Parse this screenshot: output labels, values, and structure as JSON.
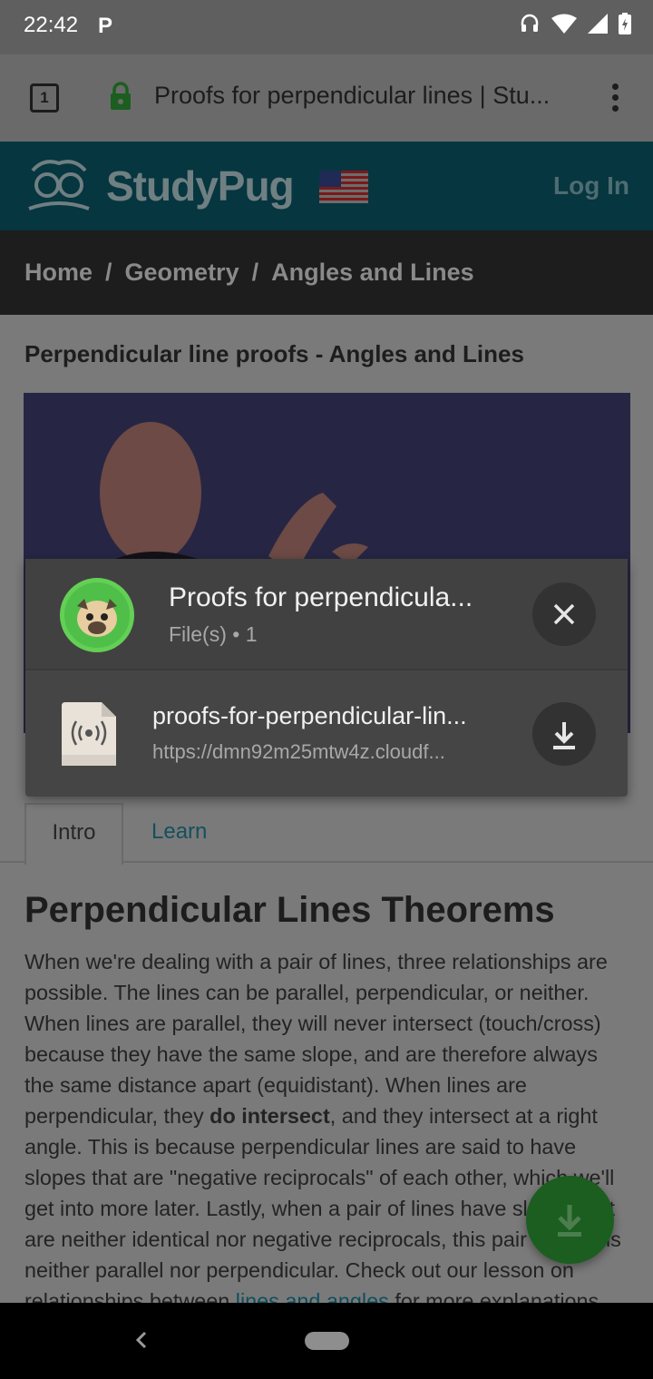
{
  "status_bar": {
    "time": "22:42",
    "notification_letter": "P"
  },
  "toolbar": {
    "tab_count": "1",
    "url": "Proofs for perpendicular lines | Stu..."
  },
  "site_header": {
    "logo_text": "StudyPug",
    "login_label": "Log In"
  },
  "breadcrumb": {
    "items": [
      "Home",
      "Geometry",
      "Angles and Lines"
    ],
    "separator": "/"
  },
  "page": {
    "lesson_title": "Perpendicular line proofs - Angles and Lines",
    "tabs": [
      {
        "label": "Intro"
      },
      {
        "label": "Learn"
      }
    ],
    "heading": "Perpendicular Lines Theorems",
    "article": {
      "part1": "When we're dealing with a pair of lines, three relationships are possible. The lines can be parallel, perpendicular, or neither. When lines are parallel, they will never intersect (touch/cross) because they have the same slope, and are therefore always the same distance apart (equidistant). When lines are perpendicular, they ",
      "bold": "do intersect",
      "part2": ", and they intersect at a right angle. This is because perpendicular lines are said to have slopes that are \"negative reciprocals\" of each other, which we'll get into more later. Lastly, when a pair of lines have slopes that are neither identical nor negative reciprocals, this pair of lines is neither parallel nor perpendicular. Check out our lesson on relationships between ",
      "link": "lines and angles",
      "part3": " for more explanations."
    }
  },
  "download_sheet": {
    "title": "Proofs for perpendicula...",
    "subtitle": "File(s) • 1",
    "file_name": "proofs-for-perpendicular-lin...",
    "file_url": "https://dmn92m25mtw4z.cloudf..."
  },
  "colors": {
    "site_header": "#06363f",
    "fab": "#1b5e20",
    "avatar": "#4fbf4a"
  }
}
